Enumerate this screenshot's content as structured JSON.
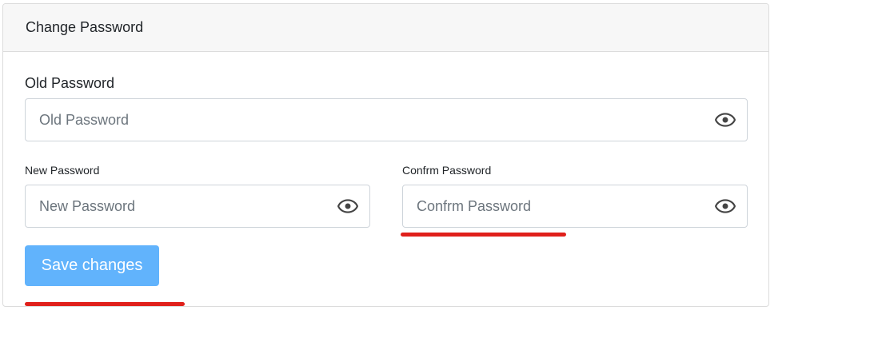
{
  "card": {
    "title": "Change Password"
  },
  "old_password": {
    "label": "Old Password",
    "placeholder": "Old Password",
    "value": ""
  },
  "new_password": {
    "label": "New Password",
    "placeholder": "New Password",
    "value": ""
  },
  "confirm_password": {
    "label": "Confrm Password",
    "placeholder": "Confrm Password",
    "value": ""
  },
  "actions": {
    "save_label": "Save changes"
  },
  "icons": {
    "toggle_visibility": "eye-icon"
  },
  "colors": {
    "primary_button": "#61b3fc",
    "annotation_underline": "#e0201b",
    "header_background": "#f7f7f7"
  }
}
